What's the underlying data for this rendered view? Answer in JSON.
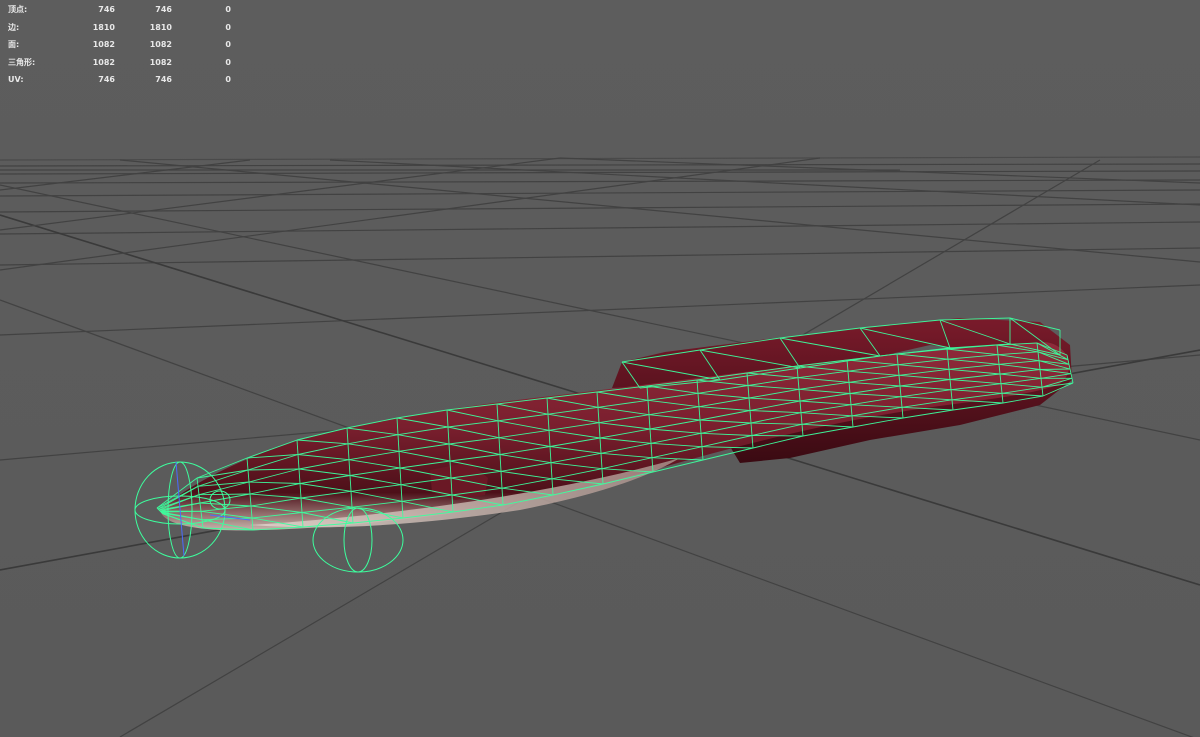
{
  "hud": {
    "rows": [
      {
        "label": "顶点:",
        "v1": "746",
        "v2": "746",
        "v3": "0"
      },
      {
        "label": "边:",
        "v1": "1810",
        "v2": "1810",
        "v3": "0"
      },
      {
        "label": "面:",
        "v1": "1082",
        "v2": "1082",
        "v3": "0"
      },
      {
        "label": "三角形:",
        "v1": "1082",
        "v2": "1082",
        "v3": "0"
      },
      {
        "label": "UV:",
        "v1": "746",
        "v2": "746",
        "v3": "0"
      }
    ]
  },
  "colors": {
    "background": "#5c5c5c",
    "grid": "#3f3f3f",
    "wireframe": "#3dff9e",
    "model_dark": "#4a0f1a",
    "model_mid": "#8a2636",
    "model_light": "#c9b8b0"
  }
}
